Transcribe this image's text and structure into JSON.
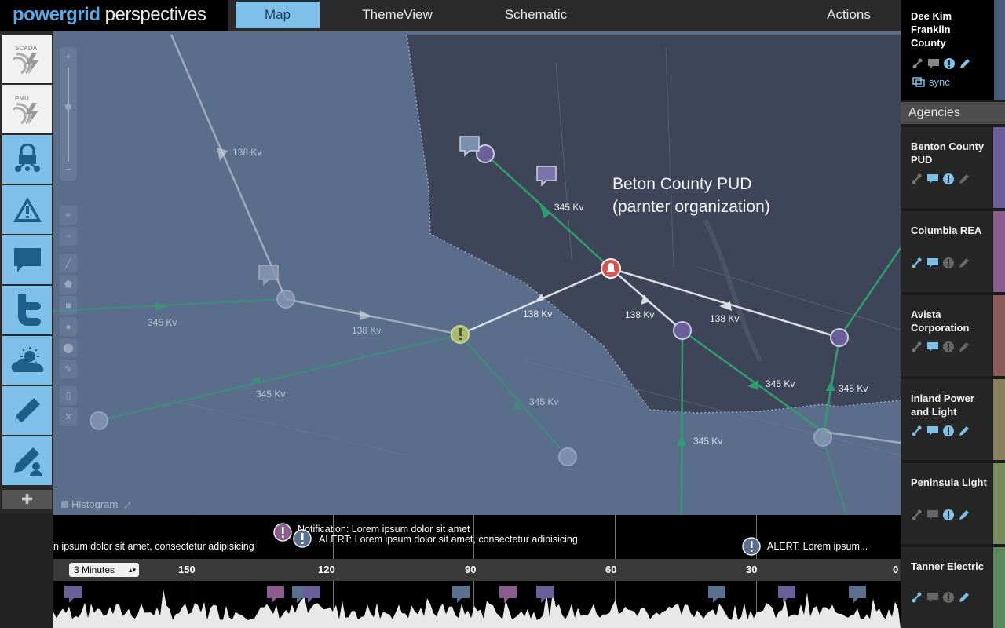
{
  "app": {
    "logo_part1": "powergrid",
    "logo_part2": " perspectives"
  },
  "nav": {
    "tabs": [
      "Map",
      "ThemeView",
      "Schematic"
    ],
    "actions": "Actions"
  },
  "user": {
    "name_line1": "Dee Kim",
    "name_line2": "Franklin",
    "name_line3": "County",
    "sync": "sync"
  },
  "agencies": {
    "title": "Agencies",
    "items": [
      {
        "name": "Benton County PUD",
        "color": "#6a5f98"
      },
      {
        "name": "Columbia REA",
        "color": "#8a5d8f"
      },
      {
        "name": "Avista Corporation",
        "color": "#8a5959"
      },
      {
        "name": "Inland Power and Light",
        "color": "#8a7f5c"
      },
      {
        "name": "Peninsula Light",
        "color": "#7a8a5c"
      },
      {
        "name": "Tanner Electric",
        "color": "#5c8a5c"
      }
    ]
  },
  "left_tools": [
    "SCADA",
    "PMU"
  ],
  "map": {
    "partner_line1": "Beton County PUD",
    "partner_line2": "(parnter organization)",
    "histogram_label": "Histogram",
    "labels_138": "138 Kv",
    "labels_345": "345 Kv"
  },
  "timeline": {
    "notification": "Notification: Lorem ipsum dolor sit amet",
    "alert1": "ALERT: Lorem ipsum dolor sit amet, consectetur adipisicing",
    "scroll_text": "n ipsum dolor sit amet, consectetur adipisicing",
    "alert2": "ALERT: Lorem ipsum...",
    "interval": "3 Minutes",
    "ticks": [
      "150",
      "120",
      "90",
      "60",
      "30",
      "0"
    ]
  },
  "colors": {
    "accent": "#7fc0e8",
    "line_green": "#2f9e6e",
    "alert_red": "#d9534f"
  }
}
